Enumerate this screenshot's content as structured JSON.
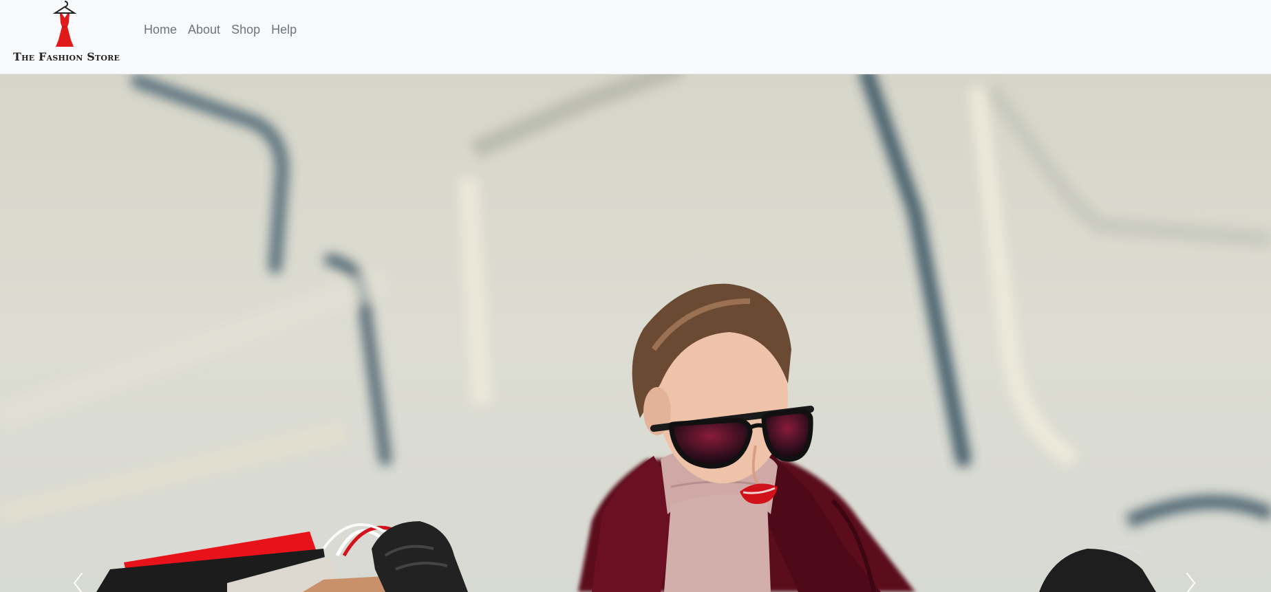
{
  "brand": {
    "name": "The Fashion Store",
    "logo_icon": "red-dress-on-hanger-icon",
    "accent_color": "#e01a1a"
  },
  "nav": {
    "items": [
      {
        "label": "Home"
      },
      {
        "label": "About"
      },
      {
        "label": "Shop"
      },
      {
        "label": "Help"
      }
    ]
  },
  "hero": {
    "image": "woman-with-sunglasses-holding-shopping-bags",
    "controls": {
      "prev_icon": "chevron-left-icon",
      "next_icon": "chevron-right-icon"
    }
  }
}
